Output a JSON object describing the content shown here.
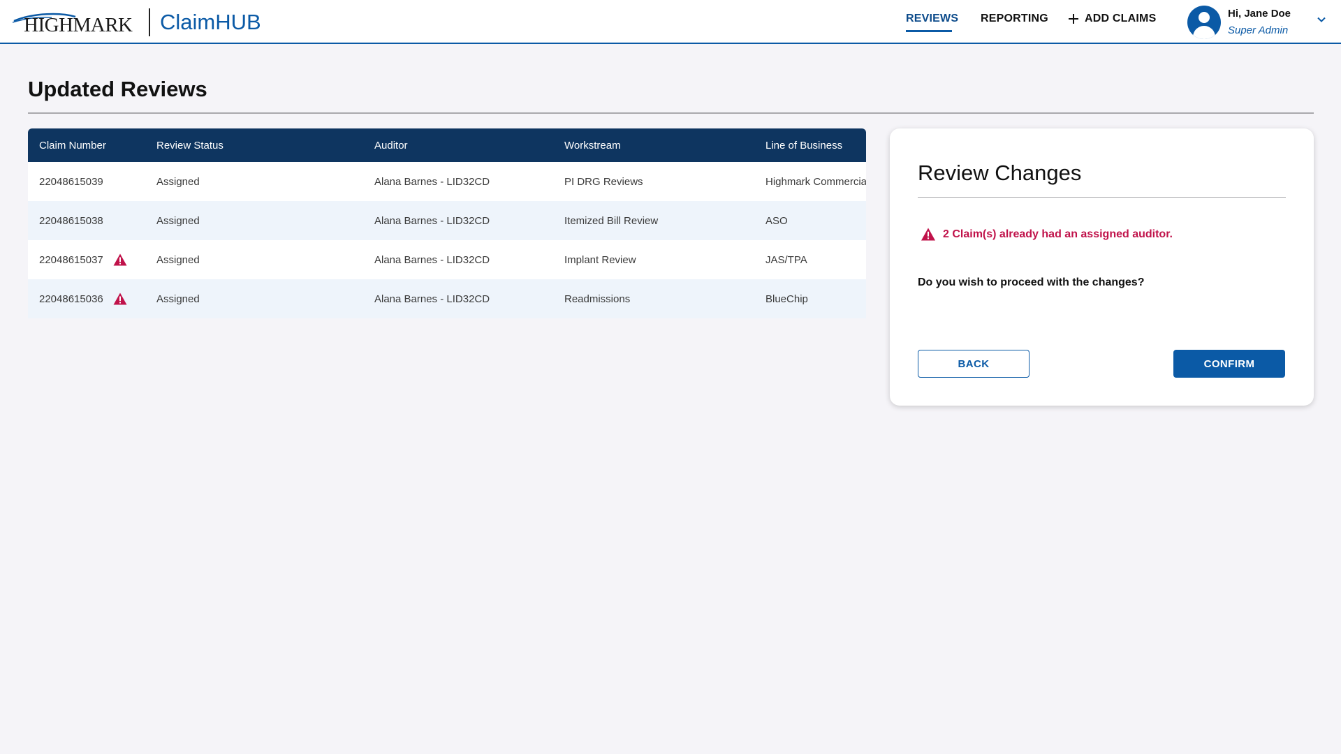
{
  "brand": {
    "logo_text": "HIGHMARK",
    "app_name": "ClaimHUB"
  },
  "nav": {
    "reviews": "REVIEWS",
    "reporting": "REPORTING",
    "add_claims": "ADD CLAIMS"
  },
  "user": {
    "greeting": "Hi, Jane Doe",
    "role": "Super Admin"
  },
  "page": {
    "title": "Updated Reviews"
  },
  "table": {
    "columns": [
      "Claim Number",
      "Review Status",
      "Auditor",
      "Workstream",
      "Line of Business"
    ],
    "rows": [
      {
        "claim": "22048615039",
        "status": "Assigned",
        "auditor": "Alana Barnes - LID32CD",
        "workstream": "PI DRG Reviews",
        "lob": "Highmark Commercial",
        "warning": false
      },
      {
        "claim": "22048615038",
        "status": "Assigned",
        "auditor": "Alana Barnes - LID32CD",
        "workstream": "Itemized Bill Review",
        "lob": "ASO",
        "warning": false
      },
      {
        "claim": "22048615037",
        "status": "Assigned",
        "auditor": "Alana Barnes - LID32CD",
        "workstream": "Implant Review",
        "lob": "JAS/TPA",
        "warning": true
      },
      {
        "claim": "22048615036",
        "status": "Assigned",
        "auditor": "Alana Barnes - LID32CD",
        "workstream": "Readmissions",
        "lob": "BlueChip",
        "warning": true
      }
    ]
  },
  "panel": {
    "title": "Review Changes",
    "alert": "2 Claim(s) already had an assigned auditor.",
    "question": "Do you wish to proceed with the changes?",
    "back_label": "BACK",
    "confirm_label": "CONFIRM"
  },
  "icons": {
    "warning": "warning-triangle-icon",
    "add": "plus-icon",
    "avatar": "user-avatar-icon",
    "dropdown": "chevron-down-icon"
  },
  "colors": {
    "brand_blue": "#0b5aa6",
    "table_header": "#0e3560",
    "alert_red": "#c0124a",
    "page_background": "#f5f4f8"
  }
}
